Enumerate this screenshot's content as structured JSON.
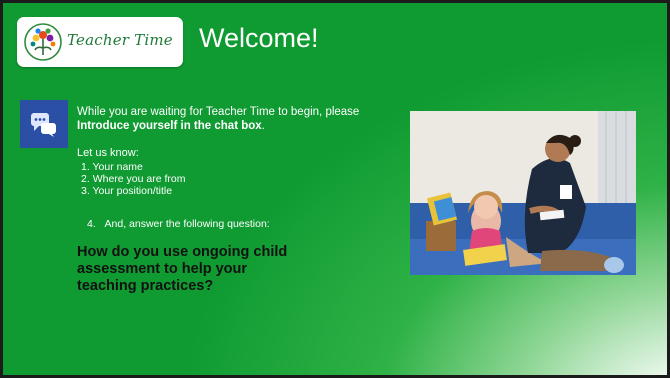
{
  "logo": {
    "brand_text": "Teacher Time"
  },
  "header": {
    "title": "Welcome!"
  },
  "intro": {
    "prefix": "While you are waiting for Teacher Time to begin, please ",
    "bold": "Introduce yourself in the chat box",
    "suffix": "."
  },
  "let_us_know": "Let us know:",
  "list": [
    {
      "num": "1.",
      "text": "Your name"
    },
    {
      "num": "2.",
      "text": "Where you are from"
    },
    {
      "num": "3.",
      "text": "Your position/title"
    }
  ],
  "item4": {
    "num": "4.",
    "text": "And, answer the following question:"
  },
  "question": "How do you use ongoing child assessment to help your teaching practices?",
  "colors": {
    "slide_green": "#0f9b32",
    "chat_icon_bg": "#2a4fa5",
    "logo_text": "#1f7a3a"
  },
  "icons": [
    "teacher-time-logo-icon",
    "chat-bubbles-icon"
  ]
}
